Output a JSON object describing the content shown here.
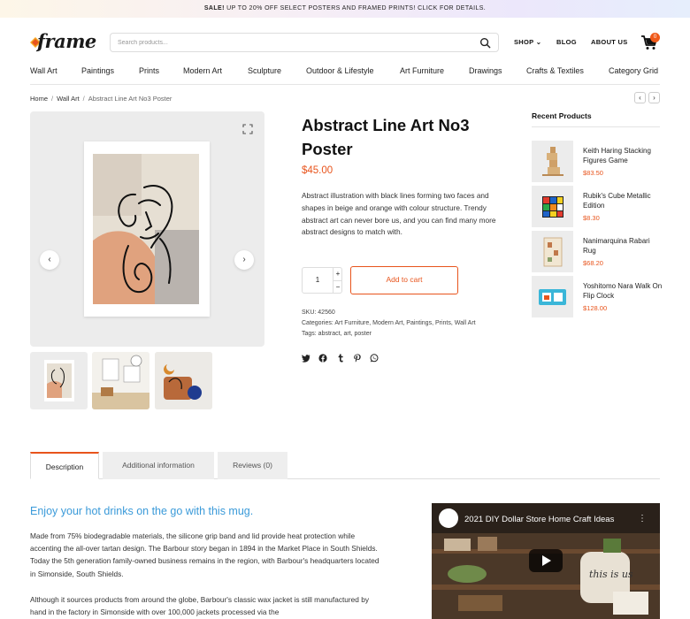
{
  "promo": {
    "bold": "SALE!",
    "rest": " UP TO 20% OFF SELECT POSTERS AND FRAMED PRINTS! CLICK FOR DETAILS."
  },
  "brand": {
    "logo_text": "frame",
    "accent": "#f05a1a",
    "price_color": "#e8541c",
    "link_blue": "#3a9ad9"
  },
  "search": {
    "placeholder": "Search products..."
  },
  "topnav": {
    "shop": "SHOP",
    "blog": "BLOG",
    "about": "ABOUT US",
    "cart_count": "0"
  },
  "categories": [
    "Wall Art",
    "Paintings",
    "Prints",
    "Modern Art",
    "Sculpture",
    "Outdoor & Lifestyle",
    "Art Furniture",
    "Drawings",
    "Crafts & Textiles",
    "Category Grid"
  ],
  "breadcrumb": {
    "home": "Home",
    "parent": "Wall Art",
    "current": "Abstract Line Art No3 Poster"
  },
  "product": {
    "title": "Abstract Line Art No3 Poster",
    "price": "$45.00",
    "description": "Abstract illustration with black lines forming two faces and shapes in beige and orange with colour structure. Trendy abstract art can never bore us, and you can find many more abstract designs to match with.",
    "qty": "1",
    "add_to_cart": "Add to cart",
    "sku": "SKU: 42560",
    "categories": "Categories: Art Furniture, Modern Art, Paintings, Prints, Wall Art",
    "tags": "Tags: abstract, art, poster"
  },
  "recent": {
    "title": "Recent Products",
    "items": [
      {
        "name": "Keith Haring Stacking Figures Game",
        "price": "$83.50"
      },
      {
        "name": "Rubik's Cube Metallic Edition",
        "price": "$8.30"
      },
      {
        "name": "Nanimarquina Rabari Rug",
        "price": "$68.20"
      },
      {
        "name": "Yoshitomo Nara Walk On Flip Clock",
        "price": "$128.00"
      }
    ]
  },
  "tabs": [
    "Description",
    "Additional information",
    "Reviews (0)"
  ],
  "content": {
    "heading": "Enjoy your hot drinks on the go with this mug.",
    "para1": "Made from 75% biodegradable materials, the silicone grip band and lid provide heat protection while accenting the all-over tartan design. The Barbour story began in 1894 in the Market Place in South Shields. Today the 5th generation family-owned business remains in the region, with Barbour's headquarters located in Simonside, South Shields.",
    "para2": "Although it sources products from around the globe, Barbour's classic wax jacket is still manufactured by hand in the factory in Simonside with over 100,000 jackets processed via the"
  },
  "video": {
    "title": "2021 DIY Dollar Store Home Craft Ideas",
    "thumb_text": "this is us"
  },
  "icons": [
    "search-icon",
    "cart-icon",
    "expand-icon",
    "chevron-left-icon",
    "chevron-right-icon",
    "twitter-icon",
    "facebook-icon",
    "tumblr-icon",
    "pinterest-icon",
    "whatsapp-icon",
    "play-icon"
  ]
}
